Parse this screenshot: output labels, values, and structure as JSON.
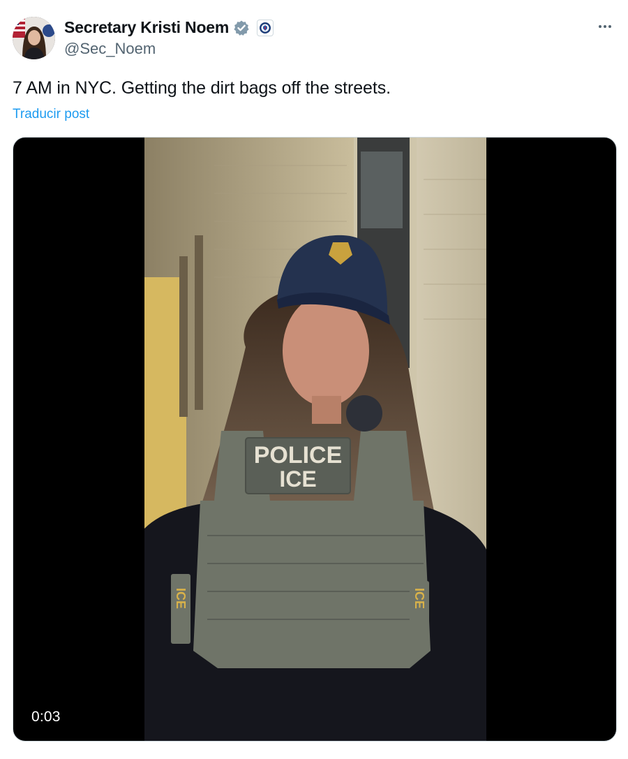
{
  "author": {
    "display_name": "Secretary Kristi Noem",
    "handle": "@Sec_Noem",
    "verified_badge": "verified-gray-check-icon",
    "affiliation_badge": "dhs-seal-icon"
  },
  "post": {
    "text": "7 AM in NYC. Getting the dirt bags off the streets.",
    "translate_label": "Traducir post"
  },
  "media": {
    "type": "video",
    "timestamp": "0:03",
    "vest_label_line1": "POLICE",
    "vest_label_line2": "ICE",
    "side_label_left": "ICE",
    "side_label_right": "ICE"
  },
  "colors": {
    "link": "#1d9bf0",
    "secondary_text": "#536471",
    "primary_text": "#0f1419",
    "verified": "#829aab"
  },
  "menu": {
    "more_icon": "more-horizontal-icon"
  }
}
